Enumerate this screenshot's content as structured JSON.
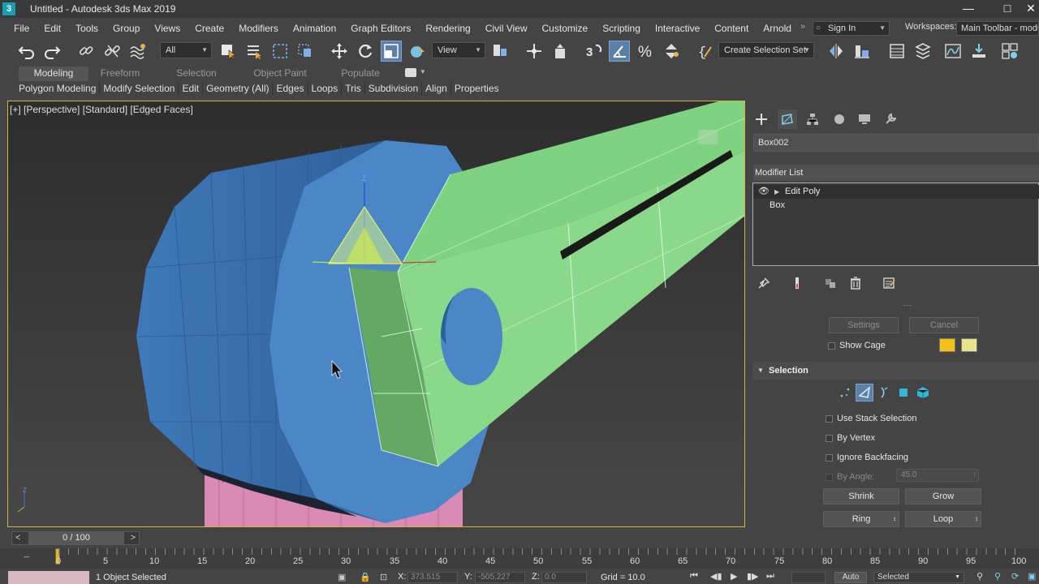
{
  "window": {
    "title": "Untitled - Autodesk 3ds Max 2019",
    "app_icon_glyph": "3",
    "controls": [
      "minimize-icon",
      "maximize-icon",
      "close-icon"
    ]
  },
  "menu": {
    "items": [
      "File",
      "Edit",
      "Tools",
      "Group",
      "Views",
      "Create",
      "Modifiers",
      "Animation",
      "Graph Editors",
      "Rendering",
      "Civil View",
      "Customize",
      "Scripting",
      "Interactive",
      "Content",
      "Arnold"
    ],
    "overflow": "»",
    "signin": "Sign In",
    "workspaces_label": "Workspaces:",
    "workspace_value": "Main Toolbar - modu"
  },
  "toolbar": {
    "selection_filter": "All",
    "ref_coord": "View",
    "create_selection_set": "Create Selection Set",
    "icons": [
      "undo-icon",
      "redo-icon",
      "link-icon",
      "unlink-icon",
      "bind-spacewarp-icon",
      "select-object-icon",
      "select-by-name-icon",
      "rectangular-selection-icon",
      "window-crossing-icon",
      "move-icon",
      "rotate-icon",
      "scale-icon",
      "placement-icon",
      "pivot-icon",
      "manipulate-icon",
      "keyboard-shortcut-icon",
      "snap-3d-icon",
      "angle-snap-icon",
      "percent-snap-icon",
      "spinner-snap-icon",
      "named-selection-icon",
      "mirror-icon",
      "align-icon",
      "layer-explorer-icon",
      "scene-explorer-icon",
      "curve-editor-icon",
      "schematic-view-icon",
      "material-editor-icon"
    ]
  },
  "ribbon": {
    "tabs": [
      "Modeling",
      "Freeform",
      "Selection",
      "Object Paint",
      "Populate"
    ],
    "active_tab": "Modeling",
    "panels": [
      "Polygon Modeling",
      "Modify Selection",
      "Edit",
      "Geometry (All)",
      "Edges",
      "Loops",
      "Tris",
      "Subdivision",
      "Align",
      "Properties"
    ]
  },
  "viewport": {
    "label": "[+] [Perspective] [Standard] [Edged Faces]",
    "gizmo_axis_label": "Z",
    "axis_tripod": "Z",
    "border_color": "#d6b443",
    "object_colors": {
      "cylinder": "#4b86c6",
      "box": "#7fd27f",
      "base": "#d98bb5"
    }
  },
  "command_panel": {
    "tabs": [
      "create-icon",
      "modify-icon",
      "hierarchy-icon",
      "motion-icon",
      "display-icon",
      "utilities-icon"
    ],
    "object_name": "Box002",
    "modifier_list_label": "Modifier List",
    "stack": [
      {
        "label": "Edit Poly",
        "selected": true
      },
      {
        "label": "Box",
        "selected": false
      }
    ],
    "stack_tool_icons": [
      "pin-stack-icon",
      "show-end-result-icon",
      "make-unique-icon",
      "remove-modifier-icon",
      "configure-modifier-sets-icon"
    ],
    "settings_button": "Settings",
    "cancel_button": "Cancel",
    "show_cage": "Show Cage",
    "cage_colors": [
      "#f5c017",
      "#e8e48a"
    ],
    "selection_rollout": {
      "title": "Selection",
      "subobject_icons": [
        "vertex-icon",
        "edge-icon",
        "border-icon",
        "polygon-icon",
        "element-icon"
      ],
      "active_subobject": "edge-icon",
      "options": [
        {
          "label": "Use Stack Selection",
          "enabled": true
        },
        {
          "label": "By Vertex",
          "enabled": true
        },
        {
          "label": "Ignore Backfacing",
          "enabled": true
        },
        {
          "label": "By Angle:",
          "enabled": false
        }
      ],
      "by_angle_value": "45.0",
      "shrink": "Shrink",
      "grow": "Grow",
      "ring": "Ring",
      "loop": "Loop"
    }
  },
  "timeline": {
    "slider_value": "0 / 100",
    "prev": "<",
    "next": ">",
    "ticks": [
      "0",
      "5",
      "10",
      "15",
      "20",
      "25",
      "30",
      "35",
      "40",
      "45",
      "50",
      "55",
      "60",
      "65",
      "70",
      "75",
      "80",
      "85",
      "90",
      "95",
      "100"
    ]
  },
  "status": {
    "objects_selected": "1 Object Selected",
    "x_label": "X:",
    "x_value": "373.515",
    "y_label": "Y:",
    "y_value": "-505.227",
    "z_label": "Z:",
    "z_value": "0.0",
    "grid": "Grid = 10.0",
    "auto_key": "Auto",
    "key_filter": "Selected"
  }
}
